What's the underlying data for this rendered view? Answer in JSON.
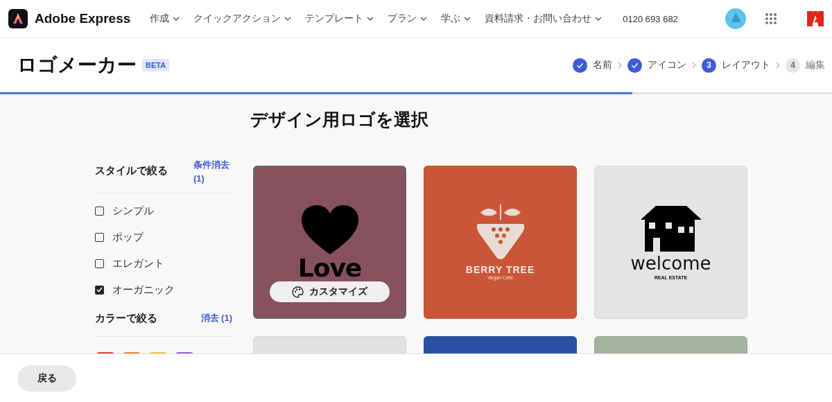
{
  "header": {
    "brand": "Adobe Express",
    "nav": [
      {
        "label": "作成"
      },
      {
        "label": "クイックアクション"
      },
      {
        "label": "テンプレート"
      },
      {
        "label": "プラン"
      },
      {
        "label": "学ぶ"
      },
      {
        "label": "資料請求・お問い合わせ"
      }
    ],
    "phone": "0120 693 682"
  },
  "title_bar": {
    "title": "ロゴメーカー",
    "badge": "BETA",
    "steps": [
      {
        "label": "名前",
        "completed": true,
        "selected": false
      },
      {
        "label": "アイコン",
        "completed": true,
        "selected": false
      },
      {
        "label": "レイアウト",
        "completed": false,
        "selected": true,
        "number": "3"
      },
      {
        "label": "編集",
        "completed": false,
        "selected": false,
        "number": "4"
      }
    ],
    "progress": {
      "level": 0.76
    }
  },
  "filters": {
    "style": {
      "title": "スタイルで絞る",
      "clear": "条件消去 (1)",
      "options": [
        {
          "label": "シンプル",
          "checked": false
        },
        {
          "label": "ポップ",
          "checked": false
        },
        {
          "label": "エレガント",
          "checked": false
        },
        {
          "label": "オーガニック",
          "checked": true
        }
      ]
    },
    "color": {
      "title": "カラーで絞る",
      "clear": "消去 (1)",
      "swatches": [
        {
          "color": "#d2463a"
        },
        {
          "color": "#e8873a"
        },
        {
          "color": "#f0c84a"
        },
        {
          "color": "#9a5ed8"
        }
      ]
    }
  },
  "gallery": {
    "heading": "デザイン用ロゴを選択",
    "cards": [
      {
        "kind": "heart",
        "color": "#875160",
        "hovered": true,
        "title": "Love",
        "customize": "カスタマイズ"
      },
      {
        "kind": "strawberry",
        "color": "#cb5537",
        "hovered": false,
        "title": "BERRY TREE",
        "subtitle": "Vegan Cafe"
      },
      {
        "kind": "house",
        "color": "#e6e4e2",
        "hovered": false,
        "title": "welcome",
        "subtitle": "REAL ESTATE"
      },
      {
        "kind": "blank",
        "color": "#e4e2e0",
        "hovered": false
      },
      {
        "kind": "blank",
        "color": "#2850a4",
        "hovered": false
      },
      {
        "kind": "blank",
        "color": "#a4b3a0",
        "hovered": false
      }
    ]
  },
  "footer": {
    "back": "戻る"
  }
}
